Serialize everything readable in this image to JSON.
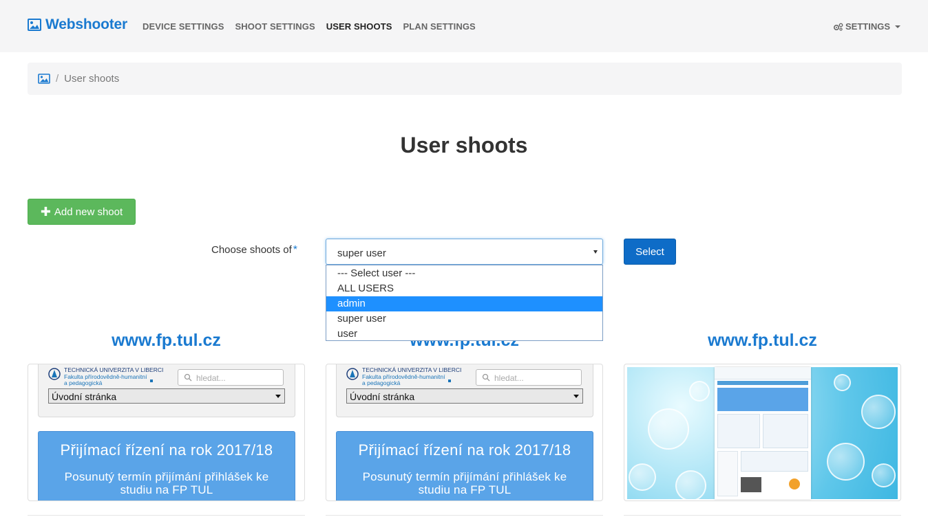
{
  "navbar": {
    "brand": "Webshooter",
    "links": [
      {
        "label": "DEVICE SETTINGS"
      },
      {
        "label": "SHOOT SETTINGS"
      },
      {
        "label": "USER SHOOTS"
      },
      {
        "label": "PLAN SETTINGS"
      }
    ],
    "settings_label": "SETTINGS"
  },
  "breadcrumb": {
    "separator": "/",
    "current": "User shoots"
  },
  "page": {
    "title": "User shoots",
    "add_button": "Add new shoot"
  },
  "form": {
    "label": "Choose shoots of",
    "required_mark": "*",
    "selected_value": "super user",
    "options": [
      {
        "label": "--- Select user ---"
      },
      {
        "label": "ALL USERS"
      },
      {
        "label": "admin"
      },
      {
        "label": "super user"
      },
      {
        "label": "user"
      }
    ],
    "highlighted_option": "admin",
    "select_button": "Select"
  },
  "shoots": [
    {
      "title": "www.fp.tul.cz",
      "preview": {
        "university": "TECHNICKÁ UNIVERZITA V LIBERCI",
        "faculty_line1": "Fakulta přírodovědně-humanitní",
        "faculty_line2": "a pedagogická",
        "search_placeholder": "hledat...",
        "menu_value": "Úvodní stránka",
        "banner_title": "Přijímací řízení na rok 2017/18",
        "banner_sub_line1": "Posunutý termín přijímání přihlášek ke",
        "banner_sub_line2": "studiu na FP TUL"
      }
    },
    {
      "title": "www.fp.tul.cz",
      "preview": {
        "university": "TECHNICKÁ UNIVERZITA V LIBERCI",
        "faculty_line1": "Fakulta přírodovědně-humanitní",
        "faculty_line2": "a pedagogická",
        "search_placeholder": "hledat...",
        "menu_value": "Úvodní stránka",
        "banner_title": "Přijímací řízení na rok 2017/18",
        "banner_sub_line1": "Posunutý termín přijímání přihlášek ke",
        "banner_sub_line2": "studiu na FP TUL"
      }
    },
    {
      "title": "www.fp.tul.cz"
    }
  ],
  "colors": {
    "brand": "#1a7ad0",
    "success": "#5cb85c",
    "primary": "#0e6cc7",
    "highlight": "#1e90ff"
  },
  "icons": {
    "brand": "image-icon",
    "breadcrumb_home": "image-icon",
    "settings": "gears-icon",
    "add": "plus-icon"
  }
}
